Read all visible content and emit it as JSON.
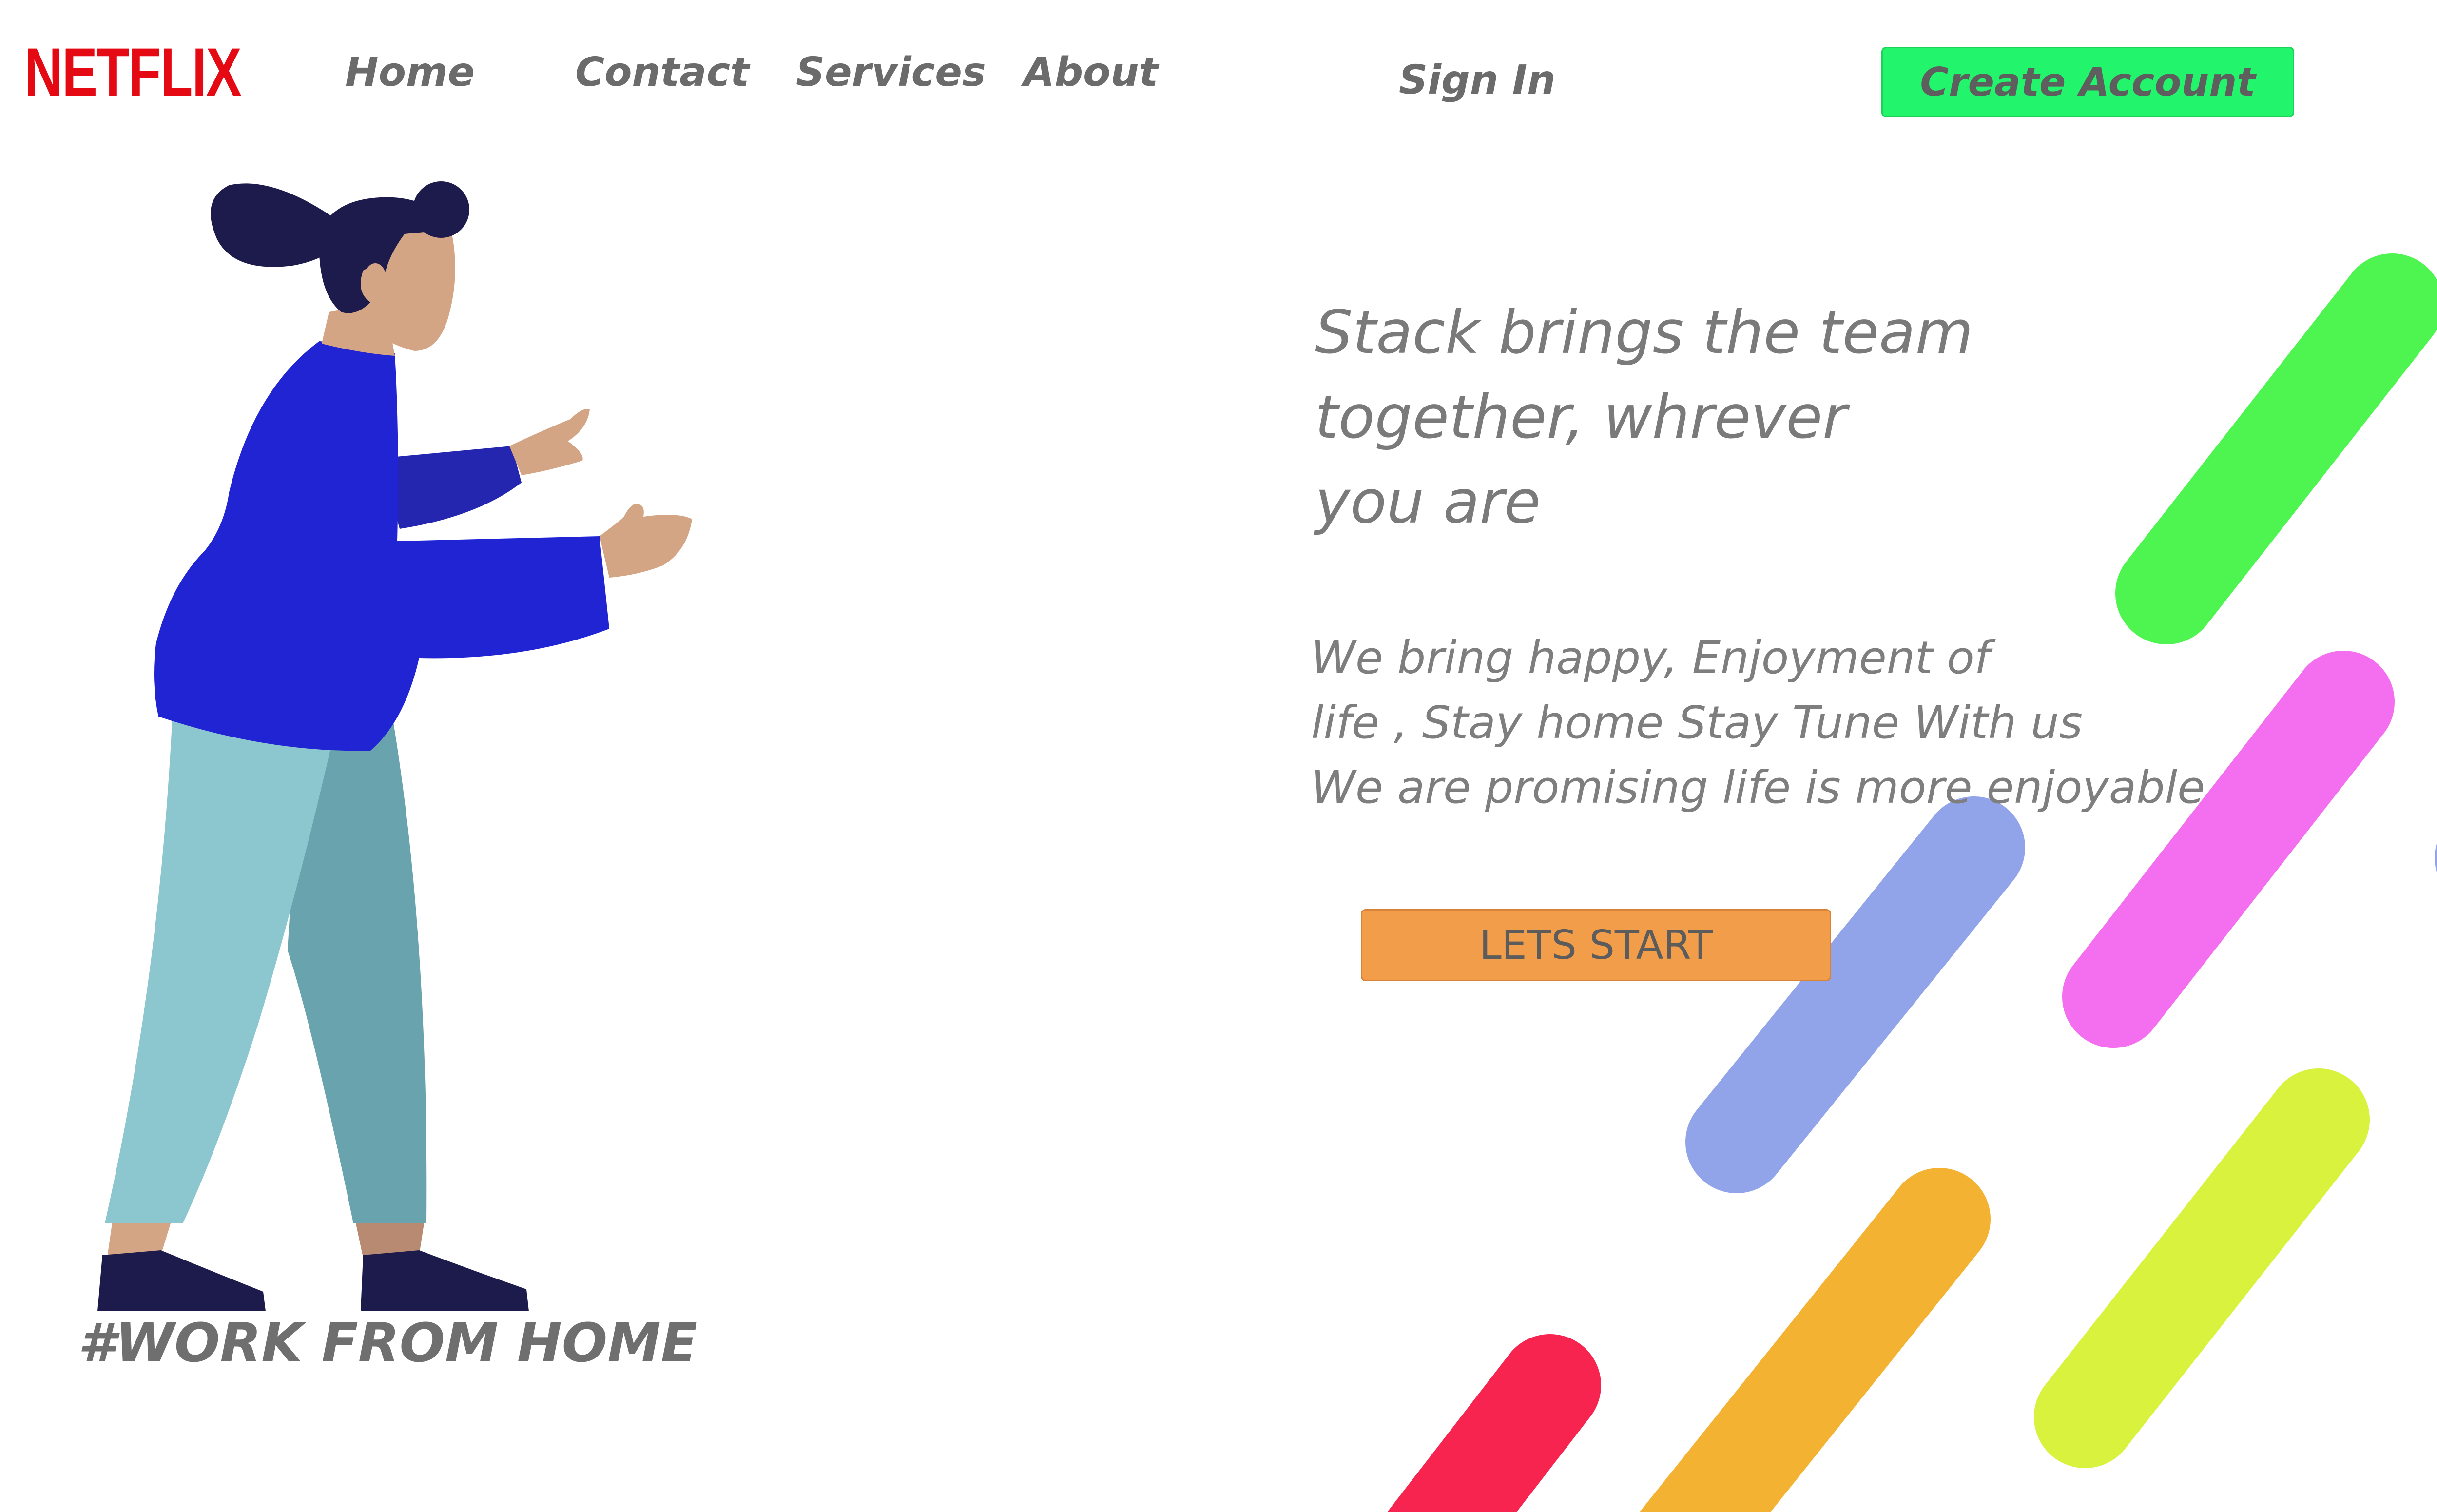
{
  "brand": {
    "logo_text": "NETFLIX",
    "logo_color": "#e50914"
  },
  "nav": {
    "home": "Home",
    "contact": "Contact",
    "services": "Services",
    "about": "About",
    "sign_in": "Sign In",
    "create_account": "Create Account"
  },
  "hero": {
    "headline": "Stack brings the team\ntogether, whrever\nyou are",
    "subtext": "We bring happy, Enjoyment of\nlife , Stay home Stay Tune With us\nWe are promising life is more enjoyable",
    "cta_label": "LETS START",
    "tagline": "#WORK FROM HOME"
  },
  "colors": {
    "create_button": "#22f46c",
    "cta_button": "#f29d4a",
    "stripe_green": "#4ef551",
    "stripe_pink": "#f46ef0",
    "stripe_periwinkle": "#92a4e9",
    "stripe_yellow": "#d8f23d",
    "stripe_orange": "#f4b232",
    "stripe_red": "#f72450"
  },
  "illustration": {
    "subject": "woman-walking-reaching-illustration"
  }
}
